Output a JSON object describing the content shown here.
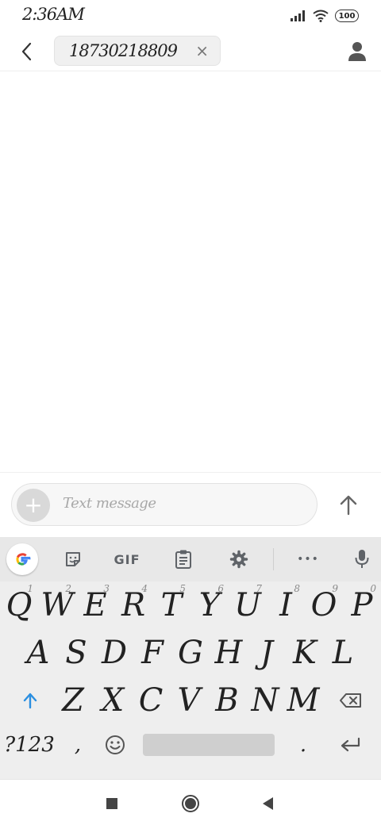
{
  "status_bar": {
    "time": "2:36AM",
    "battery": "100"
  },
  "header": {
    "recipient": "18730218809",
    "chip_close": "×"
  },
  "compose": {
    "placeholder": "Text message",
    "attach_label": "+"
  },
  "keyboard": {
    "toolbar": {
      "gif_label": "GIF",
      "more_label": "•••"
    },
    "row1": [
      {
        "label": "Q",
        "hint": "1"
      },
      {
        "label": "W",
        "hint": "2"
      },
      {
        "label": "E",
        "hint": "3"
      },
      {
        "label": "R",
        "hint": "4"
      },
      {
        "label": "T",
        "hint": "5"
      },
      {
        "label": "Y",
        "hint": "6"
      },
      {
        "label": "U",
        "hint": "7"
      },
      {
        "label": "I",
        "hint": "8"
      },
      {
        "label": "O",
        "hint": "9"
      },
      {
        "label": "P",
        "hint": "0"
      }
    ],
    "row2": [
      "A",
      "S",
      "D",
      "F",
      "G",
      "H",
      "J",
      "K",
      "L"
    ],
    "row3": [
      "Z",
      "X",
      "C",
      "V",
      "B",
      "N",
      "M"
    ],
    "symbols_label": "?123",
    "comma_label": ",",
    "period_label": "."
  },
  "icons": {
    "back": "arrow-left-icon",
    "contact": "person-icon",
    "send": "arrow-up-icon",
    "google": "google-g-icon",
    "sticker": "sticker-icon",
    "clipboard": "clipboard-icon",
    "settings": "gear-icon",
    "mic": "microphone-icon",
    "shift": "shift-arrow-icon",
    "backspace": "backspace-icon",
    "emoji": "smiley-icon",
    "enter": "enter-icon",
    "nav_recents": "square-icon",
    "nav_home": "circle-icon",
    "nav_back": "triangle-back-icon"
  },
  "colors": {
    "shift_accent": "#2b8fe0",
    "keyboard_bg": "#eeeeee"
  }
}
